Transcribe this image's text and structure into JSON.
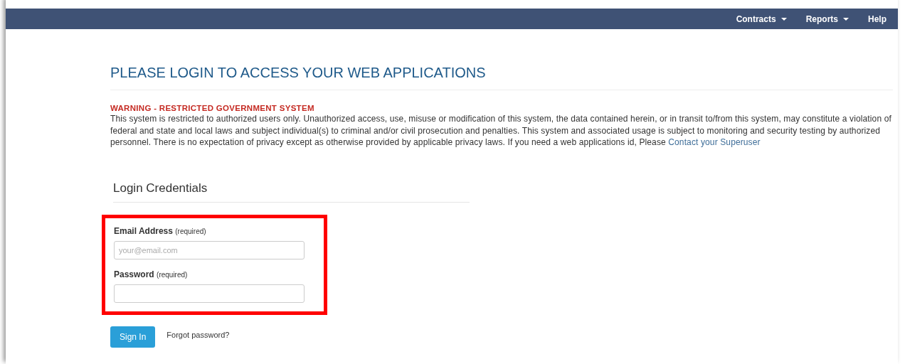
{
  "navbar": {
    "items": [
      {
        "label": "Contracts",
        "dropdown": true
      },
      {
        "label": "Reports",
        "dropdown": true
      },
      {
        "label": "Help",
        "dropdown": false
      }
    ]
  },
  "heading": "PLEASE LOGIN TO ACCESS YOUR WEB APPLICATIONS",
  "warning": {
    "title": "WARNING - RESTRICTED GOVERNMENT SYSTEM",
    "text": "This system is restricted to authorized users only. Unauthorized access, use, misuse or modification of this system, the data contained herein, or in transit to/from this system, may constitute a violation of federal and state and local laws and subject individual(s) to criminal and/or civil prosecution and penalties. This system and associated usage is subject to monitoring and security testing by authorized personnel. There is no expectation of privacy except as otherwise provided by applicable privacy laws. If you need a web applications id, Please",
    "link": "Contact your Superuser"
  },
  "login": {
    "title": "Login Credentials",
    "fields": [
      {
        "label": "Email Address",
        "hint": "(required)",
        "placeholder": "your@email.com"
      },
      {
        "label": "Password",
        "hint": "(required)"
      }
    ],
    "submit": "Sign In",
    "forgot": "Forgot password?"
  }
}
